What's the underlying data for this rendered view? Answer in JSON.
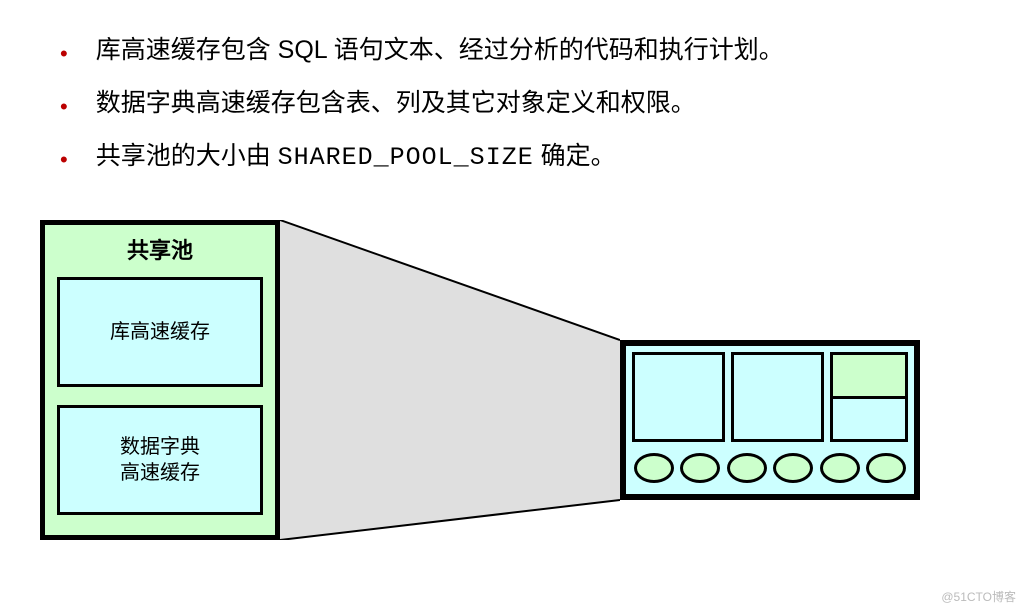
{
  "bullets": {
    "b1": "库高速缓存包含 SQL 语句文本、经过分析的代码和执行计划。",
    "b2": "数据字典高速缓存包含表、列及其它对象定义和权限。",
    "b3_pre": "共享池的大小由 ",
    "b3_code": "SHARED_POOL_SIZE",
    "b3_post": " 确定。"
  },
  "diagram": {
    "shared_pool_title": "共享池",
    "library_cache": "库高速缓存",
    "data_dict_cache": "数据字典\n高速缓存"
  },
  "colors": {
    "green": "#ccffcc",
    "cyan": "#ccffff",
    "bullet": "#bb0000"
  },
  "watermark": "@51CTO博客"
}
